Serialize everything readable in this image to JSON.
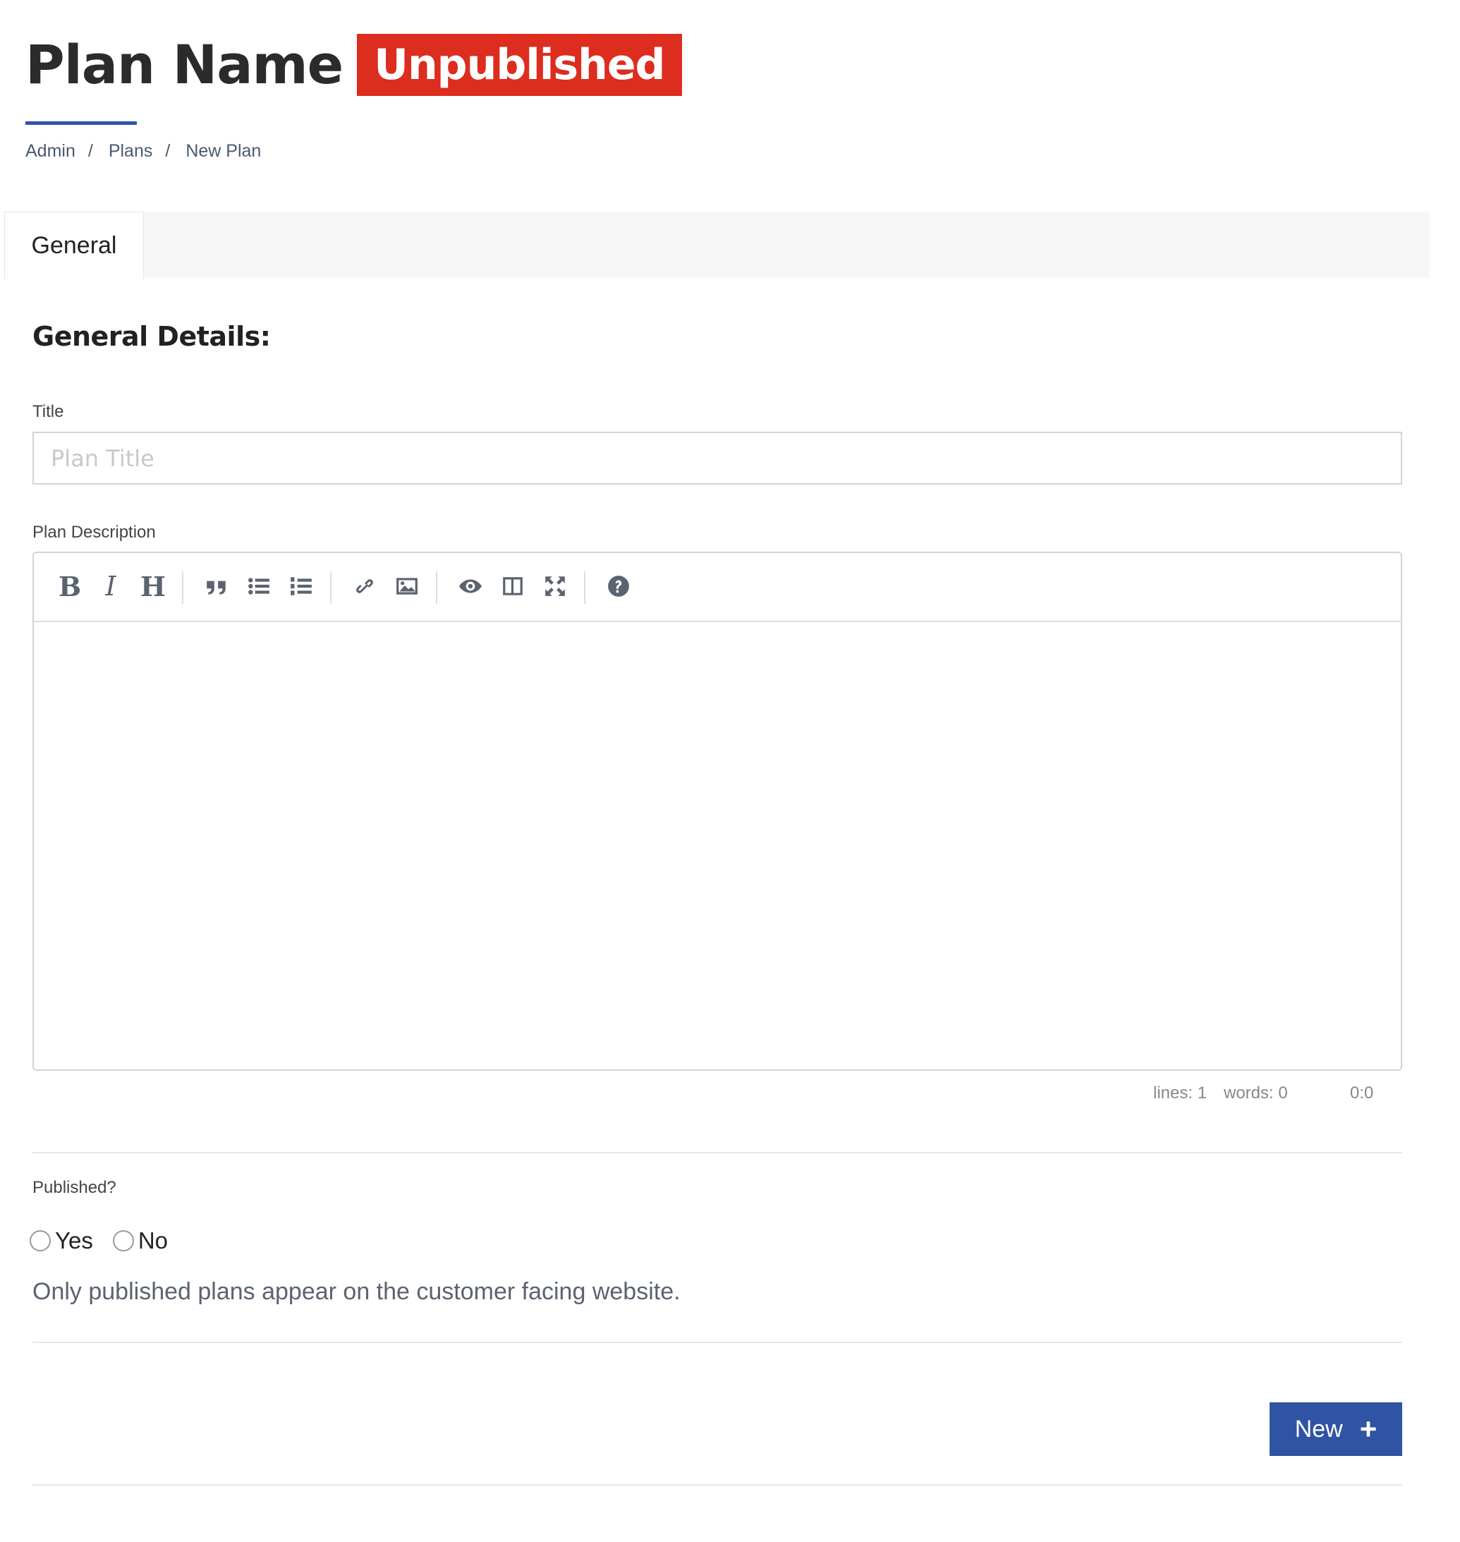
{
  "header": {
    "title": "Plan Name",
    "status_badge": "Unpublished",
    "breadcrumb": [
      "Admin",
      "Plans",
      "New Plan"
    ],
    "breadcrumb_separator": "/"
  },
  "tabs": [
    {
      "label": "General",
      "active": true
    }
  ],
  "section": {
    "heading": "General Details:"
  },
  "form": {
    "title_label": "Title",
    "title_placeholder": "Plan Title",
    "title_value": "",
    "description_label": "Plan Description",
    "editor_toolbar": {
      "bold": "B",
      "italic": "I",
      "heading": "H",
      "icons": [
        "bold-icon",
        "italic-icon",
        "heading-icon",
        "quote-icon",
        "unordered-list-icon",
        "ordered-list-icon",
        "link-icon",
        "image-icon",
        "preview-icon",
        "side-by-side-icon",
        "fullscreen-icon",
        "help-icon"
      ]
    },
    "editor_status": {
      "lines": "lines: 1",
      "words": "words: 0",
      "cursor": "0:0"
    },
    "published_label": "Published?",
    "published_options": [
      "Yes",
      "No"
    ],
    "published_selected": null,
    "published_help": "Only published plans appear on the customer facing website."
  },
  "actions": {
    "new_label": "New",
    "new_icon": "plus-icon"
  },
  "colors": {
    "accent": "#2f54a3",
    "badge": "#dc2d1e",
    "text": "#333333",
    "muted": "#5b6370"
  }
}
